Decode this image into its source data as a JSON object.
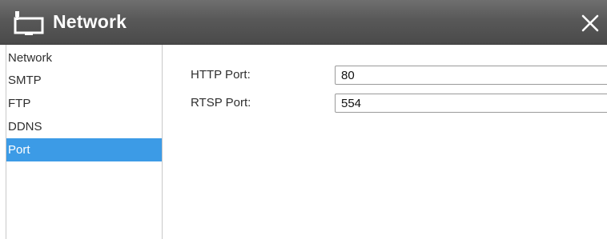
{
  "window": {
    "title": "Network",
    "title_icon": "network-monitor-icon",
    "close_icon": "close-icon",
    "close_glyph": "✕"
  },
  "sidebar": {
    "items": [
      {
        "label": "Network",
        "active": false
      },
      {
        "label": "SMTP",
        "active": false
      },
      {
        "label": "FTP",
        "active": false
      },
      {
        "label": "DDNS",
        "active": false
      },
      {
        "label": "Port",
        "active": true
      }
    ]
  },
  "port_settings": {
    "http_port": {
      "label": "HTTP Port:",
      "value": "80"
    },
    "rtsp_port": {
      "label": "RTSP Port:",
      "value": "554"
    }
  },
  "colors": {
    "titlebar": "#585858",
    "active_item": "#3c9be6",
    "text": "#2f2f2f"
  }
}
